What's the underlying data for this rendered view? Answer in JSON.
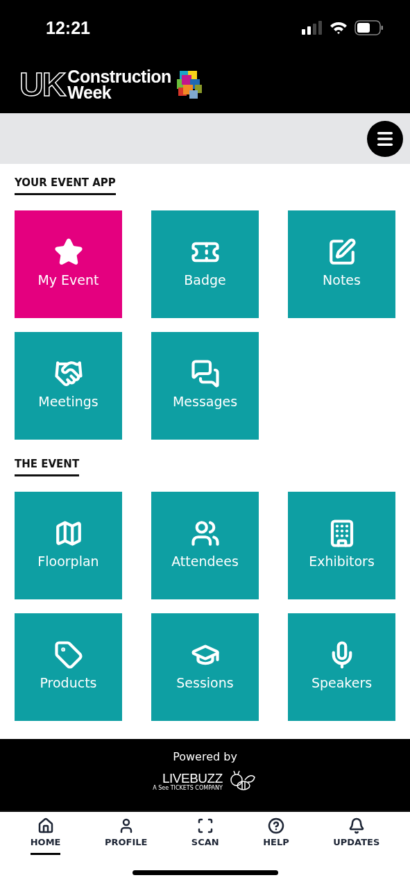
{
  "status_bar": {
    "time": "12:21"
  },
  "header": {
    "logo_mark": "UK",
    "logo_name": "Construction",
    "logo_sub": "Week"
  },
  "sections": [
    {
      "title": "YOUR EVENT APP",
      "tiles": [
        {
          "label": "My Event",
          "color": "#e4007f"
        },
        {
          "label": "Badge",
          "color": "#0e9fa3"
        },
        {
          "label": "Notes",
          "color": "#0e9fa3"
        },
        {
          "label": "Meetings",
          "color": "#0e9fa3"
        },
        {
          "label": "Messages",
          "color": "#0e9fa3"
        }
      ]
    },
    {
      "title": "THE EVENT",
      "tiles": [
        {
          "label": "Floorplan",
          "color": "#0e9fa3"
        },
        {
          "label": "Attendees",
          "color": "#0e9fa3"
        },
        {
          "label": "Exhibitors",
          "color": "#0e9fa3"
        },
        {
          "label": "Products",
          "color": "#0e9fa3"
        },
        {
          "label": "Sessions",
          "color": "#0e9fa3"
        },
        {
          "label": "Speakers",
          "color": "#0e9fa3"
        }
      ]
    }
  ],
  "footer": {
    "powered_by": "Powered by",
    "brand": "LIVE**BUZZ**",
    "tagline": "A See TICKETS COMPANY"
  },
  "bottom_nav": [
    {
      "label": "HOME",
      "selected": true
    },
    {
      "label": "PROFILE",
      "selected": false
    },
    {
      "label": "SCAN",
      "selected": false
    },
    {
      "label": "HELP",
      "selected": false
    },
    {
      "label": "UPDATES",
      "selected": false
    }
  ]
}
